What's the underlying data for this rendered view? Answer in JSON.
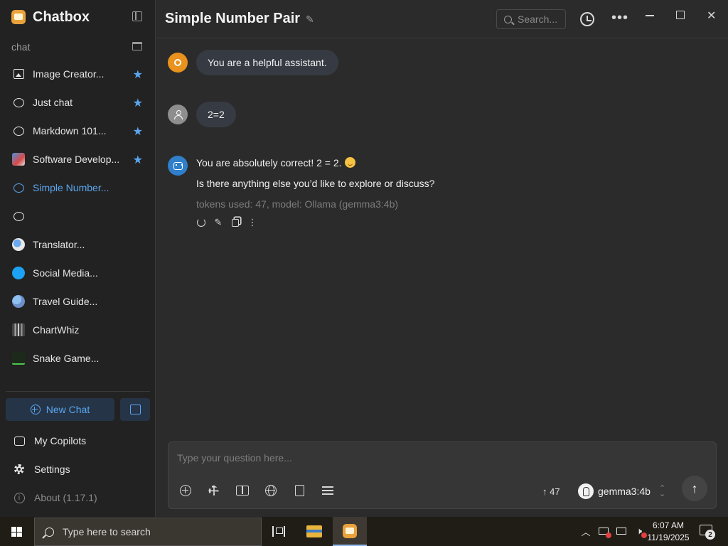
{
  "app": {
    "name": "Chatbox",
    "chat_title": "Simple Number Pair"
  },
  "sidebar": {
    "section_label": "chat",
    "items": [
      {
        "label": "Image Creator...",
        "icon": "image-icon",
        "starred": true
      },
      {
        "label": "Just chat",
        "icon": "chat-bubble-icon",
        "starred": true
      },
      {
        "label": "Markdown 101...",
        "icon": "chat-bubble-icon",
        "starred": true
      },
      {
        "label": "Software Develop...",
        "icon": "developer-avatar-icon",
        "starred": true
      },
      {
        "label": "Simple Number...",
        "icon": "chat-bubble-icon",
        "starred": false,
        "active": true
      },
      {
        "label": "",
        "icon": "chat-bubble-icon",
        "starred": false
      },
      {
        "label": "Translator...",
        "icon": "translator-avatar-icon",
        "starred": false
      },
      {
        "label": "Social Media...",
        "icon": "twitter-avatar-icon",
        "starred": false
      },
      {
        "label": "Travel Guide...",
        "icon": "travel-avatar-icon",
        "starred": false
      },
      {
        "label": "ChartWhiz",
        "icon": "chart-avatar-icon",
        "starred": false
      },
      {
        "label": "Snake Game...",
        "icon": "snake-avatar-icon",
        "starred": false
      }
    ],
    "new_chat_label": "New Chat",
    "nav": {
      "copilots": "My Copilots",
      "settings": "Settings",
      "about": "About (1.17.1)"
    }
  },
  "header": {
    "search_placeholder": "Search..."
  },
  "messages": {
    "system": "You are a helpful assistant.",
    "user": "2=2",
    "assistant_line1": "You are absolutely correct! 2 = 2.",
    "assistant_line2": "Is there anything else you’d like to explore or discuss?",
    "meta": "tokens used: 47, model: Ollama (gemma3:4b)"
  },
  "composer": {
    "placeholder": "Type your question here...",
    "token_count": "47",
    "model": "gemma3:4b"
  },
  "taskbar": {
    "search_placeholder": "Type here to search",
    "time": "6:07 AM",
    "date": "11/19/2025",
    "notification_count": "2"
  },
  "colors": {
    "accent": "#5ba6f0",
    "sidebar_bg": "#222222",
    "main_bg": "#2b2b2b",
    "bubble_bg": "#363a42"
  }
}
